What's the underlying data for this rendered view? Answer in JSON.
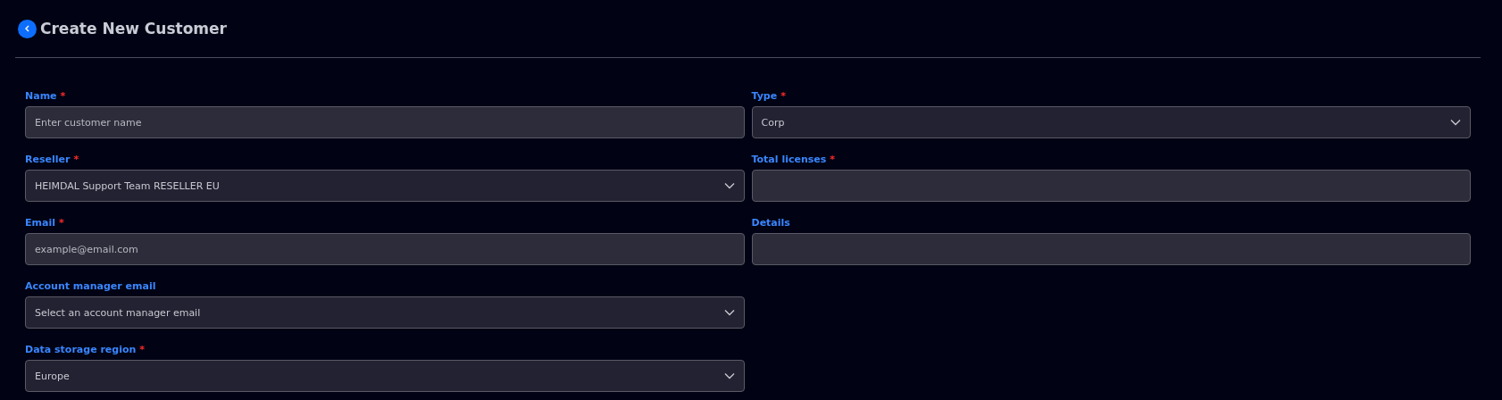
{
  "header": {
    "title": "Create New Customer"
  },
  "left_fields": [
    {
      "label": "Name",
      "required_mark": "*",
      "kind": "input",
      "placeholder": "Enter customer name"
    },
    {
      "label": "Reseller",
      "required_mark": "*",
      "kind": "select",
      "value": "HEIMDAL Support Team RESELLER EU"
    },
    {
      "label": "Email",
      "required_mark": "*",
      "kind": "input",
      "placeholder": "example@email.com"
    },
    {
      "label": "Account manager email",
      "kind": "select",
      "value": "Select an account manager email"
    },
    {
      "label": "Data storage region",
      "required_mark": "*",
      "kind": "select",
      "value": "Europe"
    }
  ],
  "right_fields": [
    {
      "label": "Type",
      "required_mark": "*",
      "kind": "select",
      "value": "Corp"
    },
    {
      "label": "Total licenses",
      "required_mark": "*",
      "kind": "input"
    },
    {
      "label": "Details",
      "kind": "input"
    }
  ]
}
